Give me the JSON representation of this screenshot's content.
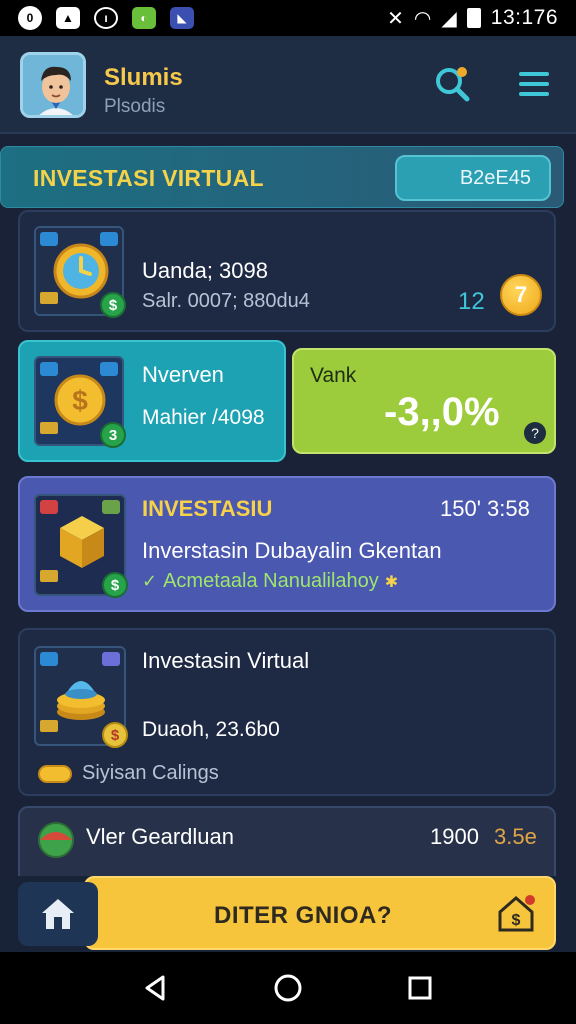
{
  "status": {
    "time": "13:176"
  },
  "header": {
    "user_name": "Slumis",
    "user_sub": "Plsodis"
  },
  "banner": {
    "title": "INVESTASI VIRTUAL",
    "button": "B2eE45"
  },
  "card1": {
    "title": "Uanda; 3098",
    "subtitle": "Salr. 0007; 880du4",
    "count": "12",
    "coin": "7"
  },
  "card2": {
    "title": "Nverven",
    "subtitle": "Mahier /4098",
    "badge": "3"
  },
  "card3": {
    "label": "Vank",
    "value": "-3,,0%",
    "help": "?"
  },
  "card4": {
    "title": "INVESTASIU",
    "meta": "150' 3:58",
    "subtitle": "Inverstasin Dubayalin Gkentan",
    "note": "Acmetaala Nanualilahoy",
    "badge": "$"
  },
  "card5": {
    "title": "Investasin Virtual",
    "subtitle": "Duaoh, 23.6b0",
    "footer": "Siyisan Calings",
    "badge": "$"
  },
  "card6": {
    "title": "Vler Geardluan",
    "value": "1900",
    "extra": "3.5e"
  },
  "cta": {
    "label": "DITER GNIOA?"
  },
  "colors": {
    "accent": "#f6c53c",
    "teal": "#1da3b5",
    "lime": "#9ccb3b",
    "purple": "#4a58b0"
  }
}
